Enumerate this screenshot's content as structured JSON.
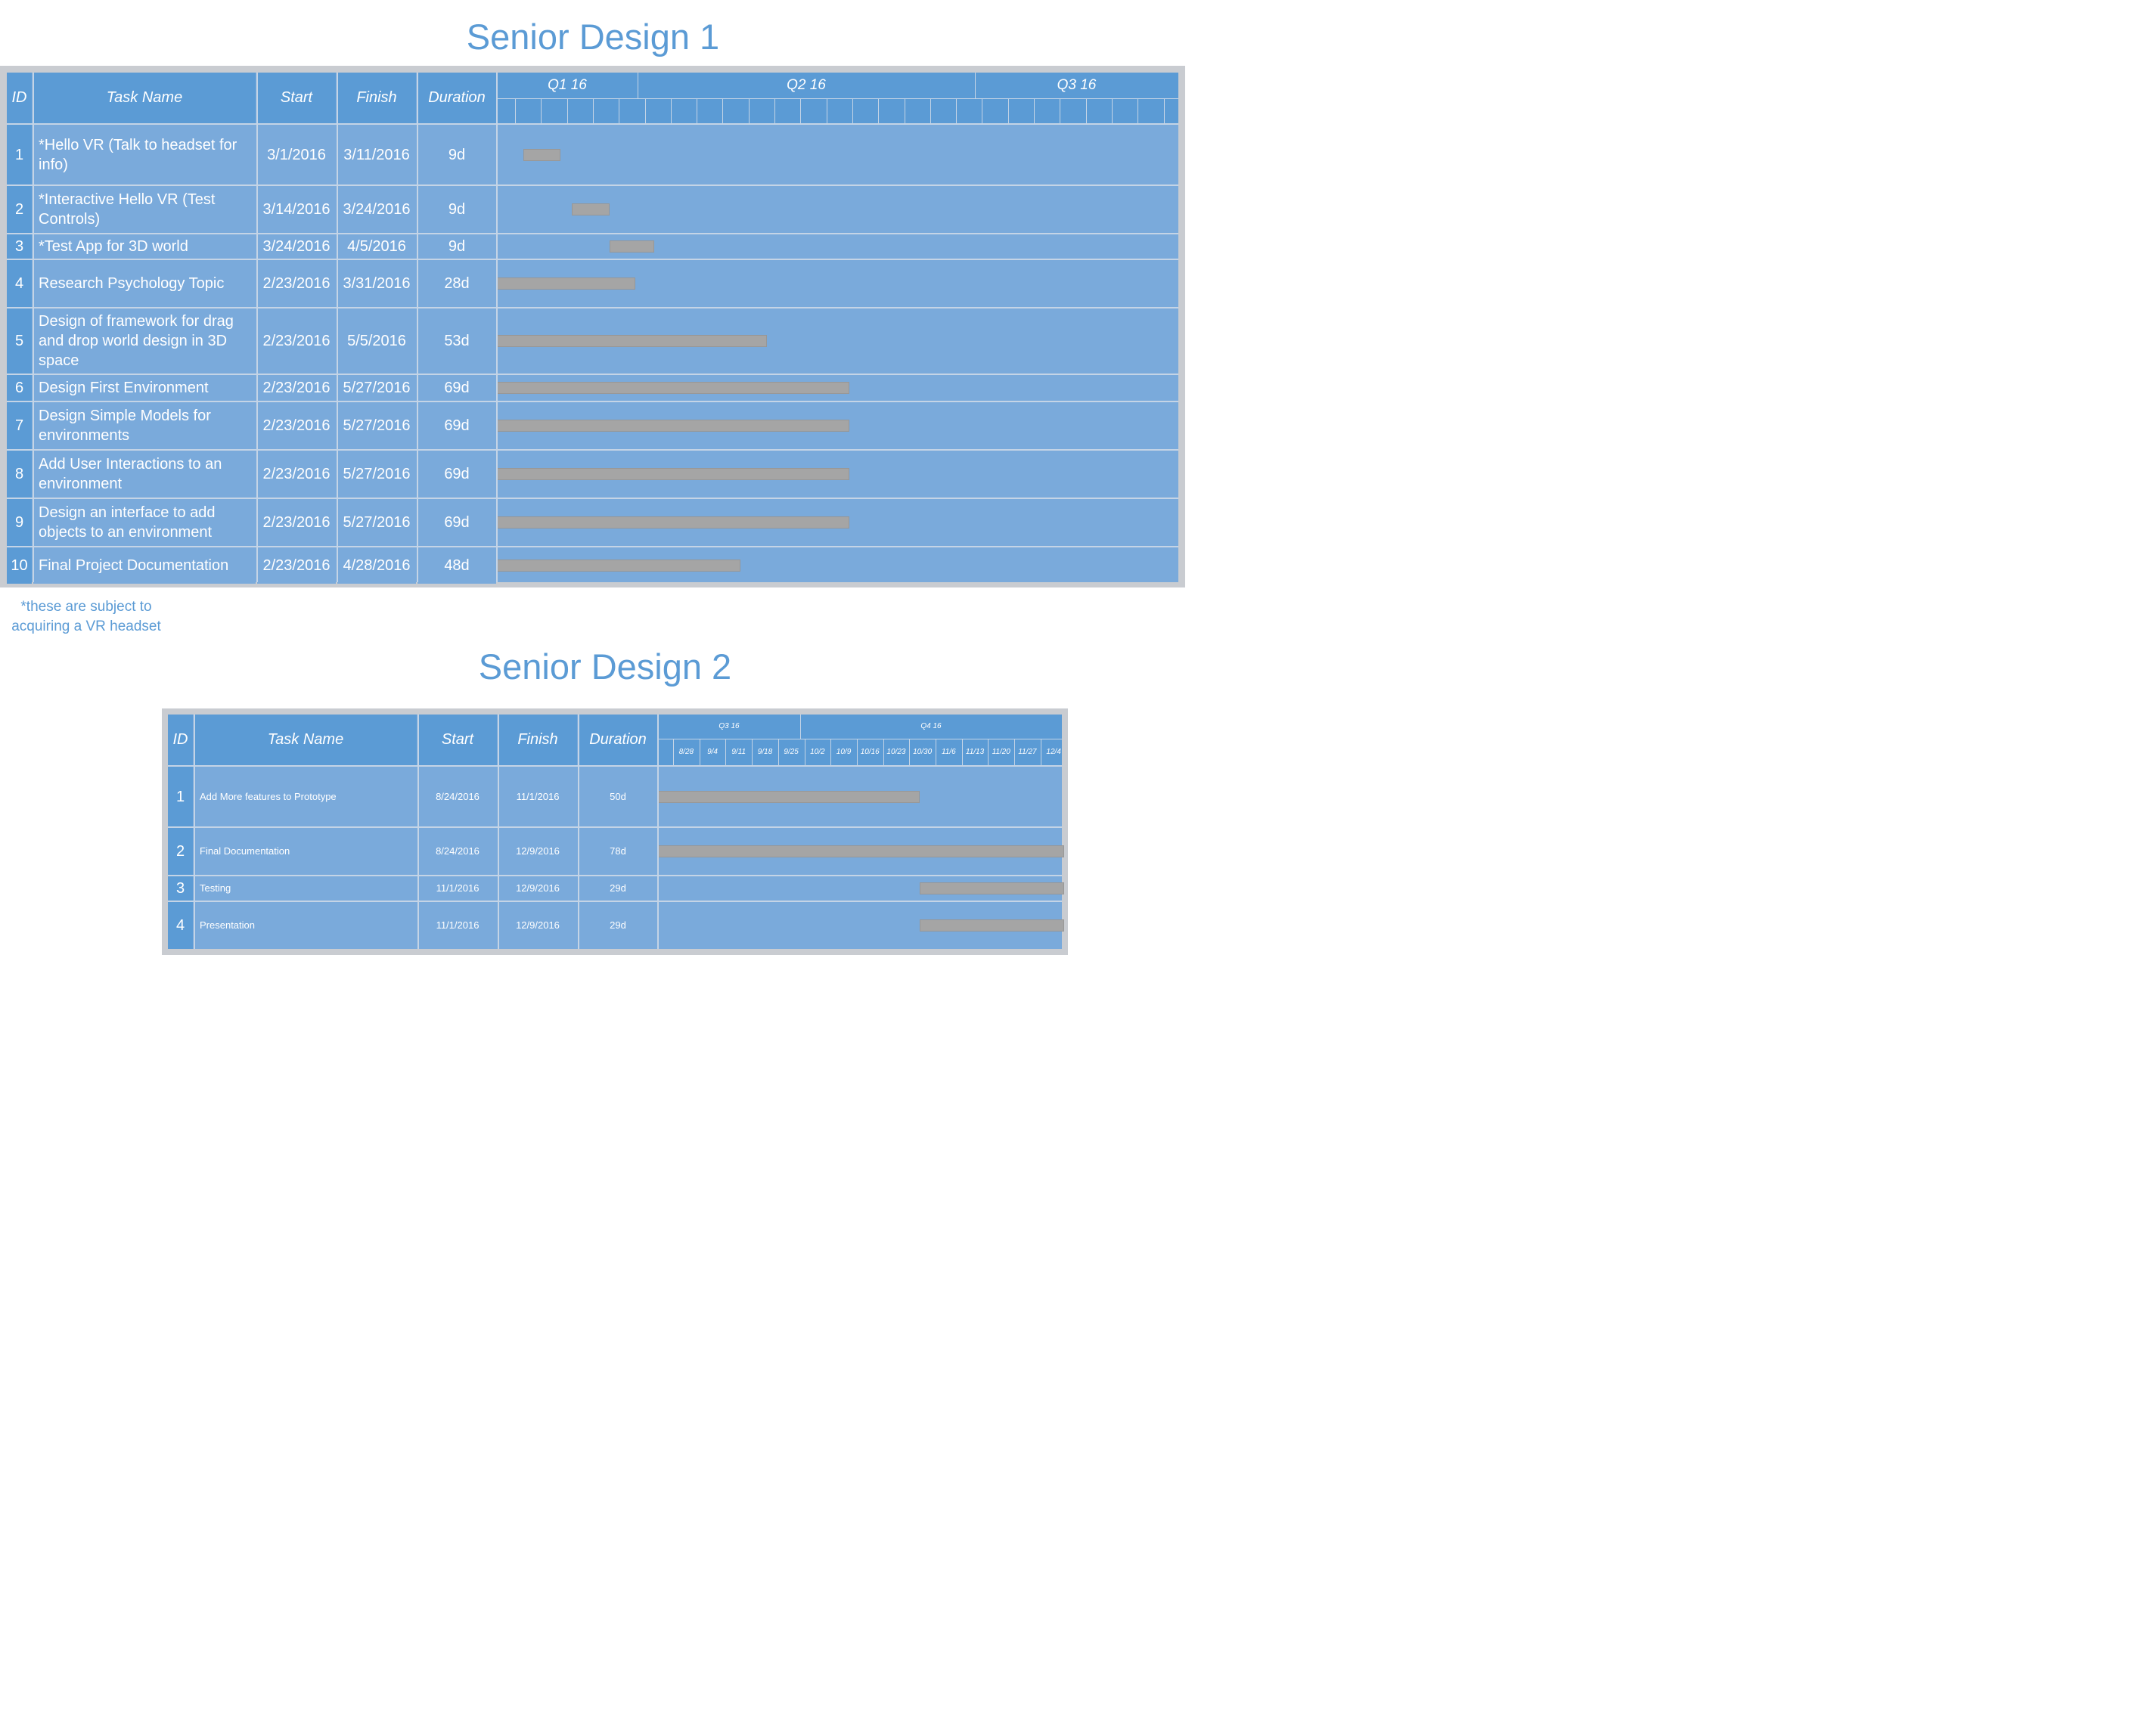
{
  "chart_data": [
    {
      "type": "gantt",
      "title": "Senior Design 1",
      "columns": [
        "ID",
        "Task Name",
        "Start",
        "Finish",
        "Duration"
      ],
      "quarters": [
        "Q1 16",
        "Q2 16",
        "Q3 16"
      ],
      "tasks": [
        {
          "id": "1",
          "name": "*Hello VR (Talk to headset for info)",
          "start": "3/1/2016",
          "finish": "3/11/2016",
          "duration": "9d"
        },
        {
          "id": "2",
          "name": "*Interactive Hello VR (Test Controls)",
          "start": "3/14/2016",
          "finish": "3/24/2016",
          "duration": "9d"
        },
        {
          "id": "3",
          "name": "*Test App for 3D world",
          "start": "3/24/2016",
          "finish": "4/5/2016",
          "duration": "9d"
        },
        {
          "id": "4",
          "name": "Research Psychology Topic",
          "start": "2/23/2016",
          "finish": "3/31/2016",
          "duration": "28d"
        },
        {
          "id": "5",
          "name": "Design of framework for drag and drop world design in 3D space",
          "start": "2/23/2016",
          "finish": "5/5/2016",
          "duration": "53d"
        },
        {
          "id": "6",
          "name": "Design First Environment",
          "start": "2/23/2016",
          "finish": "5/27/2016",
          "duration": "69d"
        },
        {
          "id": "7",
          "name": "Design Simple Models for environments",
          "start": "2/23/2016",
          "finish": "5/27/2016",
          "duration": "69d"
        },
        {
          "id": "8",
          "name": "Add User Interactions to an environment",
          "start": "2/23/2016",
          "finish": "5/27/2016",
          "duration": "69d"
        },
        {
          "id": "9",
          "name": "Design an interface to add objects to an environment",
          "start": "2/23/2016",
          "finish": "5/27/2016",
          "duration": "69d"
        },
        {
          "id": "10",
          "name": "Final Project Documentation",
          "start": "2/23/2016",
          "finish": "4/28/2016",
          "duration": "48d"
        }
      ],
      "note": "*these are subject to acquiring a VR headset"
    },
    {
      "type": "gantt",
      "title": "Senior Design 2",
      "columns": [
        "ID",
        "Task Name",
        "Start",
        "Finish",
        "Duration"
      ],
      "quarters": [
        "Q3 16",
        "Q4 16"
      ],
      "weeks": [
        "8/28",
        "9/4",
        "9/11",
        "9/18",
        "9/25",
        "10/2",
        "10/9",
        "10/16",
        "10/23",
        "10/30",
        "11/6",
        "11/13",
        "11/20",
        "11/27",
        "12/4"
      ],
      "tasks": [
        {
          "id": "1",
          "name": "Add More features to Prototype",
          "start": "8/24/2016",
          "finish": "11/1/2016",
          "duration": "50d"
        },
        {
          "id": "2",
          "name": "Final Documentation",
          "start": "8/24/2016",
          "finish": "12/9/2016",
          "duration": "78d"
        },
        {
          "id": "3",
          "name": "Testing",
          "start": "11/1/2016",
          "finish": "12/9/2016",
          "duration": "29d"
        },
        {
          "id": "4",
          "name": "Presentation",
          "start": "11/1/2016",
          "finish": "12/9/2016",
          "duration": "29d"
        }
      ]
    }
  ]
}
